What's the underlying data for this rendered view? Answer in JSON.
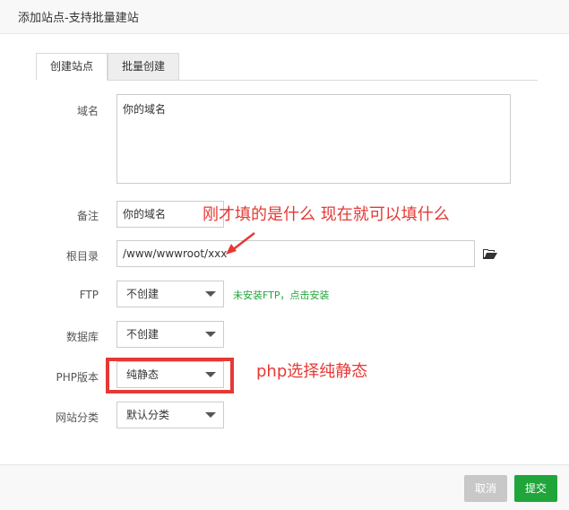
{
  "window": {
    "title": "添加站点-支持批量建站"
  },
  "tabs": {
    "create_site": "创建站点",
    "batch_create": "批量创建"
  },
  "form": {
    "domain": {
      "label": "域名",
      "value": "你的域名"
    },
    "remark": {
      "label": "备注",
      "value": "你的域名"
    },
    "root_dir": {
      "label": "根目录",
      "value": "/www/wwwroot/xxx"
    },
    "ftp": {
      "label": "FTP",
      "selected": "不创建",
      "hint": "未安装FTP，点击安装"
    },
    "database": {
      "label": "数据库",
      "selected": "不创建"
    },
    "php_version": {
      "label": "PHP版本",
      "selected": "纯静态"
    },
    "site_category": {
      "label": "网站分类",
      "selected": "默认分类"
    }
  },
  "annotations": {
    "remark_note": "刚才填的是什么  现在就可以填什么",
    "php_note": "php选择纯静态"
  },
  "footer": {
    "cancel_label": "取消",
    "submit_label": "提交"
  },
  "colors": {
    "accent_green": "#20a53a",
    "annotation_red": "#e53935",
    "disabled_gray": "#c8c8c8"
  },
  "icons": {
    "folder": "folder-open-icon",
    "dropdown": "chevron-down-icon",
    "arrow": "red-arrow-icon"
  }
}
